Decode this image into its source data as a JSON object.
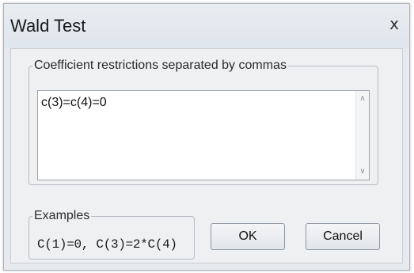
{
  "window": {
    "title": "Wald Test",
    "close_glyph": "x"
  },
  "restrictions": {
    "label": "Coefficient restrictions separated by commas",
    "value": "c(3)=c(4)=0"
  },
  "examples": {
    "label": "Examples",
    "text": "C(1)=0,  C(3)=2*C(4)"
  },
  "buttons": {
    "ok_label": "OK",
    "cancel_label": "Cancel"
  }
}
